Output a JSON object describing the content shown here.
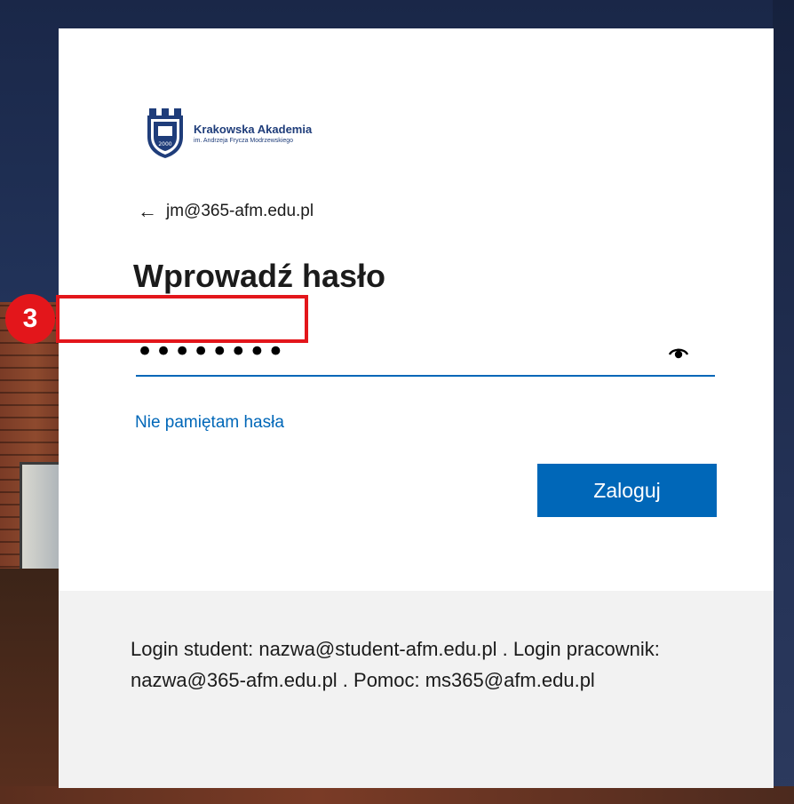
{
  "brand": {
    "name": "Krakowska Akademia",
    "subtitle": "im. Andrzeja Frycza Modrzewskiego",
    "shield_year": "2000",
    "accent": "#1f3d7a"
  },
  "account": {
    "back_icon": "arrow-left-icon",
    "email": "jm@365-afm.edu.pl"
  },
  "title": "Wprowadź hasło",
  "password": {
    "value": "••••••••",
    "reveal_icon": "eye-icon"
  },
  "annotation": {
    "step": "3",
    "color": "#e3161b"
  },
  "forgot_link": "Nie pamiętam hasła",
  "signin_button": "Zaloguj",
  "primary_color": "#0067b8",
  "footer": {
    "text": "Login student: nazwa@student-afm.edu.pl . Login pracownik: nazwa@365-afm.edu.pl . Pomoc: ms365@afm.edu.pl"
  }
}
